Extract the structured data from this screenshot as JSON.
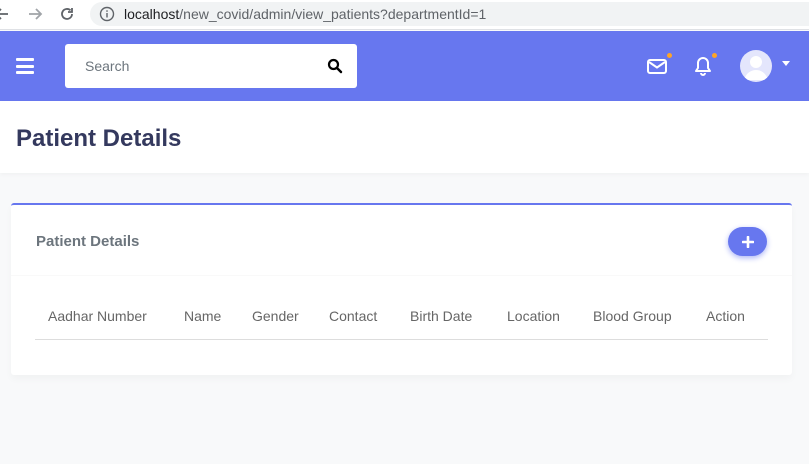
{
  "browser": {
    "url_host": "localhost",
    "url_path": "/new_covid/admin/view_patients?departmentId=1"
  },
  "topnav": {
    "search_placeholder": "Search",
    "brand_color": "#6777ef",
    "icons": [
      "menu-icon",
      "search-icon",
      "envelope-icon",
      "bell-icon",
      "user-avatar-icon"
    ]
  },
  "page": {
    "title": "Patient Details"
  },
  "card": {
    "title": "Patient Details",
    "add_button_icon": "plus-icon"
  },
  "table": {
    "columns": [
      "Aadhar Number",
      "Name",
      "Gender",
      "Contact",
      "Birth Date",
      "Location",
      "Blood Group",
      "Action"
    ],
    "rows": []
  }
}
